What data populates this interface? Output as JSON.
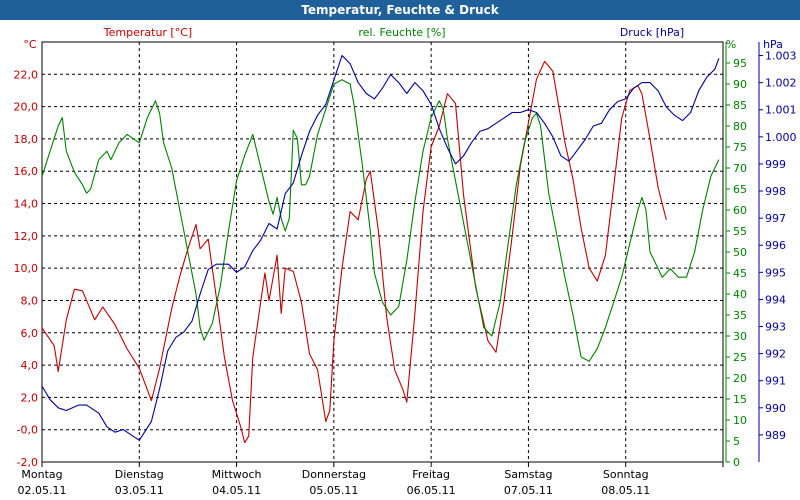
{
  "window": {
    "title": "Temperatur, Feuchte & Druck"
  },
  "chart_data": {
    "type": "line",
    "title": "Temperatur, Feuchte & Druck",
    "x_axis": {
      "range_hours": [
        0,
        168
      ],
      "day_labels": [
        {
          "day": "Montag",
          "date": "02.05.11"
        },
        {
          "day": "Dienstag",
          "date": "03.05.11"
        },
        {
          "day": "Mittwoch",
          "date": "04.05.11"
        },
        {
          "day": "Donnerstag",
          "date": "05.05.11"
        },
        {
          "day": "Freitag",
          "date": "06.05.11"
        },
        {
          "day": "Samstag",
          "date": "07.05.11"
        },
        {
          "day": "Sonntag",
          "date": "08.05.11"
        }
      ]
    },
    "axes": {
      "temperature": {
        "unit": "°C",
        "label": "Temperatur [°C]",
        "ylim": [
          -2,
          24
        ],
        "ticks": [
          -2.0,
          0.0,
          2.0,
          4.0,
          6.0,
          8.0,
          10.0,
          12.0,
          14.0,
          16.0,
          18.0,
          20.0,
          22.0
        ],
        "tick_labels": [
          "-2,0",
          "-0,0",
          "2,0",
          "4,0",
          "6,0",
          "8,0",
          "10,0",
          "12,0",
          "14,0",
          "16,0",
          "18,0",
          "20,0",
          "22,0"
        ],
        "color": "#c00000"
      },
      "humidity": {
        "unit": "%",
        "label": "rel. Feuchte [%]",
        "ylim": [
          0,
          100
        ],
        "ticks": [
          0,
          5,
          10,
          15,
          20,
          25,
          30,
          35,
          40,
          45,
          50,
          55,
          60,
          65,
          70,
          75,
          80,
          85,
          90,
          95
        ],
        "tick_labels": [
          "0",
          "5",
          "10",
          "15",
          "20",
          "25",
          "30",
          "35",
          "40",
          "45",
          "50",
          "55",
          "60",
          "65",
          "70",
          "75",
          "80",
          "85",
          "90",
          "95"
        ],
        "color": "#008000"
      },
      "pressure": {
        "unit": "hPa",
        "label": "Druck [hPa]",
        "ylim": [
          988,
          1003.5
        ],
        "ticks": [
          989,
          990,
          991,
          992,
          993,
          994,
          995,
          996,
          997,
          998,
          999,
          1000,
          1001,
          1002,
          1003
        ],
        "tick_labels": [
          "989",
          "990",
          "991",
          "992",
          "993",
          "994",
          "995",
          "996",
          "997",
          "998",
          "999",
          "1.000",
          "1.001",
          "1.002",
          "1.003"
        ],
        "color": "#0000a0"
      }
    },
    "grid": true,
    "series": [
      {
        "name": "Temperatur [°C]",
        "axis": "temperature",
        "color": "#c00000",
        "points": [
          [
            0,
            6.3
          ],
          [
            3,
            5.2
          ],
          [
            4,
            3.6
          ],
          [
            6,
            6.8
          ],
          [
            8,
            8.7
          ],
          [
            10,
            8.6
          ],
          [
            13,
            6.8
          ],
          [
            15,
            7.6
          ],
          [
            18,
            6.5
          ],
          [
            21,
            5.0
          ],
          [
            24,
            3.8
          ],
          [
            27,
            1.8
          ],
          [
            29,
            3.8
          ],
          [
            32,
            7.5
          ],
          [
            34,
            9.5
          ],
          [
            36,
            11.2
          ],
          [
            38,
            12.7
          ],
          [
            39,
            11.2
          ],
          [
            41,
            11.8
          ],
          [
            43,
            8.2
          ],
          [
            45,
            4.5
          ],
          [
            47,
            1.8
          ],
          [
            49,
            0.2
          ],
          [
            50,
            -0.8
          ],
          [
            51,
            -0.4
          ],
          [
            52,
            4.5
          ],
          [
            54,
            8.0
          ],
          [
            55,
            9.7
          ],
          [
            56,
            8.0
          ],
          [
            58,
            10.8
          ],
          [
            59,
            7.2
          ],
          [
            60,
            10.0
          ],
          [
            62,
            9.8
          ],
          [
            64,
            7.9
          ],
          [
            66,
            4.7
          ],
          [
            68,
            3.7
          ],
          [
            70,
            0.5
          ],
          [
            71,
            1.2
          ],
          [
            72,
            5.5
          ],
          [
            74,
            10.0
          ],
          [
            76,
            13.5
          ],
          [
            78,
            13.0
          ],
          [
            80,
            15.5
          ],
          [
            81,
            16.0
          ],
          [
            83,
            12.3
          ],
          [
            85,
            7.0
          ],
          [
            87,
            3.7
          ],
          [
            89,
            2.5
          ],
          [
            90,
            1.7
          ],
          [
            92,
            7.2
          ],
          [
            94,
            13.5
          ],
          [
            96,
            17.5
          ],
          [
            98,
            18.8
          ],
          [
            100,
            20.8
          ],
          [
            102,
            20.2
          ],
          [
            104,
            14.5
          ],
          [
            107,
            8.8
          ],
          [
            110,
            5.5
          ],
          [
            112,
            4.8
          ],
          [
            114,
            8.0
          ],
          [
            116,
            12.0
          ],
          [
            118,
            16.3
          ],
          [
            120,
            19.0
          ],
          [
            122,
            21.7
          ],
          [
            124,
            22.8
          ],
          [
            126,
            22.2
          ],
          [
            129,
            17.8
          ],
          [
            131,
            15.5
          ],
          [
            133,
            12.5
          ],
          [
            135,
            10.0
          ],
          [
            137,
            9.2
          ],
          [
            139,
            10.8
          ],
          [
            141,
            15.0
          ],
          [
            143,
            19.3
          ],
          [
            145,
            21.0
          ],
          [
            147,
            21.3
          ],
          [
            148,
            20.8
          ],
          [
            150,
            18.0
          ],
          [
            152,
            15.0
          ],
          [
            154,
            13.0
          ]
        ]
      },
      {
        "name": "rel. Feuchte [%]",
        "axis": "humidity",
        "color": "#008000",
        "points": [
          [
            0,
            68
          ],
          [
            2,
            74
          ],
          [
            4,
            80
          ],
          [
            5,
            82
          ],
          [
            6,
            74
          ],
          [
            8,
            69
          ],
          [
            10,
            66
          ],
          [
            11,
            64
          ],
          [
            12,
            65
          ],
          [
            14,
            72
          ],
          [
            16,
            74
          ],
          [
            17,
            72
          ],
          [
            19,
            76
          ],
          [
            21,
            78
          ],
          [
            24,
            76
          ],
          [
            26,
            82
          ],
          [
            28,
            86
          ],
          [
            29,
            83
          ],
          [
            30,
            76
          ],
          [
            32,
            70
          ],
          [
            34,
            60
          ],
          [
            36,
            50
          ],
          [
            38,
            40
          ],
          [
            39,
            32
          ],
          [
            40,
            29
          ],
          [
            42,
            33
          ],
          [
            44,
            42
          ],
          [
            46,
            55
          ],
          [
            48,
            67
          ],
          [
            50,
            73
          ],
          [
            52,
            78
          ],
          [
            54,
            70
          ],
          [
            56,
            62
          ],
          [
            57,
            59
          ],
          [
            58,
            63
          ],
          [
            59,
            58
          ],
          [
            60,
            55
          ],
          [
            61,
            58
          ],
          [
            62,
            79
          ],
          [
            63,
            77
          ],
          [
            64,
            66
          ],
          [
            65,
            66
          ],
          [
            66,
            68
          ],
          [
            68,
            78
          ],
          [
            70,
            84
          ],
          [
            72,
            90
          ],
          [
            74,
            91
          ],
          [
            76,
            90
          ],
          [
            77,
            85
          ],
          [
            79,
            71
          ],
          [
            81,
            55
          ],
          [
            82,
            45
          ],
          [
            84,
            38
          ],
          [
            86,
            35
          ],
          [
            88,
            37
          ],
          [
            90,
            48
          ],
          [
            92,
            62
          ],
          [
            94,
            74
          ],
          [
            96,
            82
          ],
          [
            98,
            86
          ],
          [
            99,
            84
          ],
          [
            100,
            77
          ],
          [
            101,
            72
          ],
          [
            103,
            62
          ],
          [
            105,
            52
          ],
          [
            107,
            42
          ],
          [
            109,
            32
          ],
          [
            111,
            30
          ],
          [
            113,
            38
          ],
          [
            115,
            52
          ],
          [
            117,
            66
          ],
          [
            119,
            76
          ],
          [
            121,
            82
          ],
          [
            122,
            83
          ],
          [
            123,
            80
          ],
          [
            125,
            64
          ],
          [
            127,
            54
          ],
          [
            129,
            44
          ],
          [
            131,
            35
          ],
          [
            133,
            25
          ],
          [
            135,
            24
          ],
          [
            137,
            27
          ],
          [
            139,
            32
          ],
          [
            141,
            38
          ],
          [
            143,
            44
          ],
          [
            145,
            52
          ],
          [
            147,
            60
          ],
          [
            148,
            63
          ],
          [
            149,
            60
          ],
          [
            150,
            50
          ],
          [
            151,
            48
          ],
          [
            153,
            44
          ],
          [
            155,
            46
          ],
          [
            157,
            44
          ],
          [
            159,
            44
          ],
          [
            161,
            50
          ],
          [
            163,
            60
          ],
          [
            165,
            68
          ],
          [
            167,
            72
          ]
        ]
      },
      {
        "name": "Druck [hPa]",
        "axis": "pressure",
        "color": "#0000a0",
        "points": [
          [
            0,
            990.8
          ],
          [
            2,
            990.3
          ],
          [
            4,
            990.0
          ],
          [
            6,
            989.9
          ],
          [
            9,
            990.1
          ],
          [
            11,
            990.1
          ],
          [
            14,
            989.8
          ],
          [
            16,
            989.3
          ],
          [
            18,
            989.1
          ],
          [
            20,
            989.2
          ],
          [
            22,
            989.0
          ],
          [
            24,
            988.8
          ],
          [
            27,
            989.5
          ],
          [
            29,
            990.7
          ],
          [
            31,
            992.1
          ],
          [
            33,
            992.6
          ],
          [
            35,
            992.8
          ],
          [
            37,
            993.2
          ],
          [
            39,
            994.2
          ],
          [
            41,
            995.1
          ],
          [
            43,
            995.3
          ],
          [
            46,
            995.3
          ],
          [
            48,
            995.0
          ],
          [
            50,
            995.2
          ],
          [
            52,
            995.8
          ],
          [
            54,
            996.2
          ],
          [
            56,
            996.8
          ],
          [
            58,
            996.6
          ],
          [
            60,
            997.9
          ],
          [
            62,
            998.3
          ],
          [
            64,
            999.3
          ],
          [
            66,
            1000.2
          ],
          [
            68,
            1000.8
          ],
          [
            70,
            1001.2
          ],
          [
            72,
            1002.1
          ],
          [
            74,
            1003.0
          ],
          [
            76,
            1002.7
          ],
          [
            78,
            1002.0
          ],
          [
            80,
            1001.6
          ],
          [
            82,
            1001.4
          ],
          [
            84,
            1001.8
          ],
          [
            86,
            1002.3
          ],
          [
            88,
            1002.0
          ],
          [
            90,
            1001.6
          ],
          [
            92,
            1002.0
          ],
          [
            94,
            1001.7
          ],
          [
            96,
            1001.2
          ],
          [
            98,
            1000.3
          ],
          [
            100,
            999.6
          ],
          [
            102,
            999.0
          ],
          [
            104,
            999.3
          ],
          [
            106,
            999.8
          ],
          [
            108,
            1000.2
          ],
          [
            110,
            1000.3
          ],
          [
            112,
            1000.5
          ],
          [
            114,
            1000.7
          ],
          [
            116,
            1000.9
          ],
          [
            118,
            1000.9
          ],
          [
            120,
            1001.0
          ],
          [
            122,
            1000.9
          ],
          [
            124,
            1000.5
          ],
          [
            126,
            1000.0
          ],
          [
            128,
            999.3
          ],
          [
            130,
            999.1
          ],
          [
            132,
            999.5
          ],
          [
            134,
            999.9
          ],
          [
            136,
            1000.4
          ],
          [
            138,
            1000.5
          ],
          [
            140,
            1001.0
          ],
          [
            142,
            1001.3
          ],
          [
            144,
            1001.4
          ],
          [
            146,
            1001.8
          ],
          [
            148,
            1002.0
          ],
          [
            150,
            1002.0
          ],
          [
            152,
            1001.7
          ],
          [
            154,
            1001.1
          ],
          [
            156,
            1000.8
          ],
          [
            158,
            1000.6
          ],
          [
            160,
            1000.9
          ],
          [
            162,
            1001.7
          ],
          [
            164,
            1002.2
          ],
          [
            166,
            1002.5
          ],
          [
            167,
            1002.9
          ]
        ]
      }
    ]
  }
}
